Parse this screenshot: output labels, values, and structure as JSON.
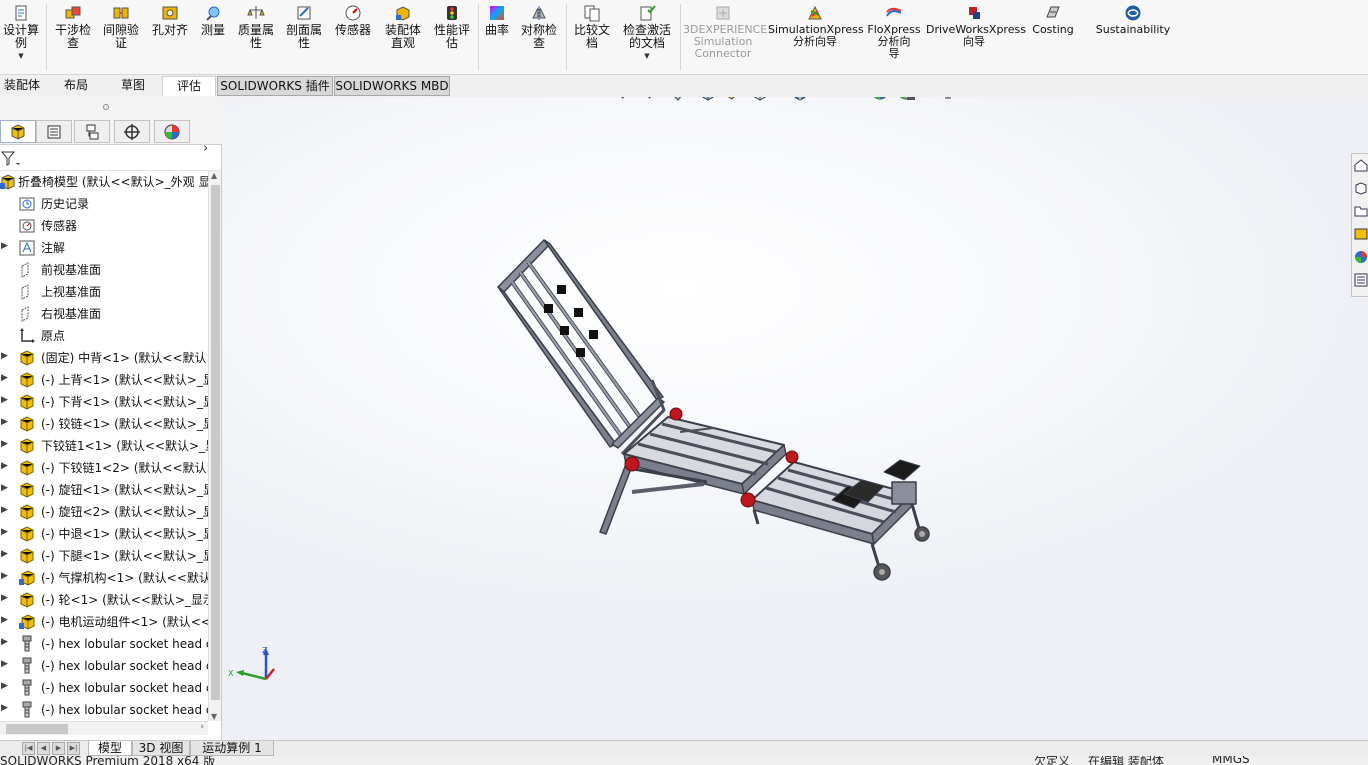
{
  "ribbon": {
    "buttons": [
      {
        "label": "设计算\n例",
        "icon": "design-study-icon"
      },
      {
        "label": "干涉检\n查",
        "icon": "interference-check-icon"
      },
      {
        "label": "间隙验\n证",
        "icon": "clearance-icon"
      },
      {
        "label": "孔对齐",
        "icon": "hole-alignment-icon"
      },
      {
        "label": "测量",
        "icon": "measure-icon"
      },
      {
        "label": "质量属\n性",
        "icon": "mass-properties-icon"
      },
      {
        "label": "剖面属\n性",
        "icon": "section-properties-icon"
      },
      {
        "label": "传感器",
        "icon": "sensor-icon"
      },
      {
        "label": "装配体\n直观",
        "icon": "assembly-visualization-icon"
      },
      {
        "label": "性能评\n估",
        "icon": "performance-evaluation-icon"
      },
      {
        "label": "曲率",
        "icon": "curvature-icon"
      },
      {
        "label": "对称检\n查",
        "icon": "symmetry-check-icon"
      },
      {
        "label": "比较文\n档",
        "icon": "compare-documents-icon"
      },
      {
        "label": "检查激活\n的文档",
        "icon": "check-active-document-icon"
      },
      {
        "label": "3DEXPERIENCE\nSimulation\nConnector",
        "icon": "3dexperience-icon"
      },
      {
        "label": "SimulationXpress\n分析向导",
        "icon": "simulationxpress-icon"
      },
      {
        "label": "FloXpress\n分析向\n导",
        "icon": "floxpress-icon"
      },
      {
        "label": "DriveWorksXpress\n向导",
        "icon": "driveworksxpress-icon"
      },
      {
        "label": "Costing",
        "icon": "costing-icon"
      },
      {
        "label": "Sustainability",
        "icon": "sustainability-icon"
      }
    ]
  },
  "command_tabs": [
    "装配体",
    "布局",
    "草图",
    "评估",
    "SOLIDWORKS 插件",
    "SOLIDWORKS MBD"
  ],
  "tree": {
    "root": "折叠椅模型 (默认<<默认>_外观 显",
    "items": [
      {
        "label": "历史记录",
        "icon": "history-folder-icon"
      },
      {
        "label": "传感器",
        "icon": "sensor-folder-icon"
      },
      {
        "label": "注解",
        "icon": "annotations-icon"
      },
      {
        "label": "前视基准面",
        "icon": "plane-icon"
      },
      {
        "label": "上视基准面",
        "icon": "plane-icon"
      },
      {
        "label": "右视基准面",
        "icon": "plane-icon"
      },
      {
        "label": "原点",
        "icon": "origin-icon"
      },
      {
        "label": "(固定) 中背<1> (默认<<默认>",
        "icon": "part-icon"
      },
      {
        "label": "(-) 上背<1> (默认<<默认>_显",
        "icon": "part-icon"
      },
      {
        "label": "(-) 下背<1> (默认<<默认>_显",
        "icon": "part-icon"
      },
      {
        "label": "(-) 铰链<1> (默认<<默认>_显",
        "icon": "part-icon"
      },
      {
        "label": "下铰链1<1> (默认<<默认>_显",
        "icon": "part-icon"
      },
      {
        "label": "(-) 下铰链1<2> (默认<<默认>",
        "icon": "part-icon"
      },
      {
        "label": "(-) 旋钮<1> (默认<<默认>_显",
        "icon": "part-icon"
      },
      {
        "label": "(-) 旋钮<2> (默认<<默认>_显",
        "icon": "part-icon"
      },
      {
        "label": "(-) 中退<1> (默认<<默认>_显",
        "icon": "part-icon"
      },
      {
        "label": "(-) 下腿<1> (默认<<默认>_显",
        "icon": "part-icon"
      },
      {
        "label": "(-) 气撑机构<1> (默认<<默认",
        "icon": "subassembly-icon"
      },
      {
        "label": "(-) 轮<1> (默认<<默认>_显示",
        "icon": "part-icon"
      },
      {
        "label": "(-) 电机运动组件<1> (默认<<",
        "icon": "subassembly-icon"
      },
      {
        "label": "(-) hex lobular socket head c",
        "icon": "screw-icon"
      },
      {
        "label": "(-) hex lobular socket head c",
        "icon": "screw-icon"
      },
      {
        "label": "(-) hex lobular socket head c",
        "icon": "screw-icon"
      },
      {
        "label": "(-) hex lobular socket head c",
        "icon": "screw-icon"
      }
    ]
  },
  "bottom_tabs": [
    "模型",
    "3D 视图",
    "运动算例 1"
  ],
  "status": {
    "app": "SOLIDWORKS Premium 2018 x64 版",
    "definition": "欠定义",
    "editing": "在编辑 装配体",
    "units": "MMGS"
  },
  "triad": {
    "z": "Z",
    "x": "X"
  }
}
